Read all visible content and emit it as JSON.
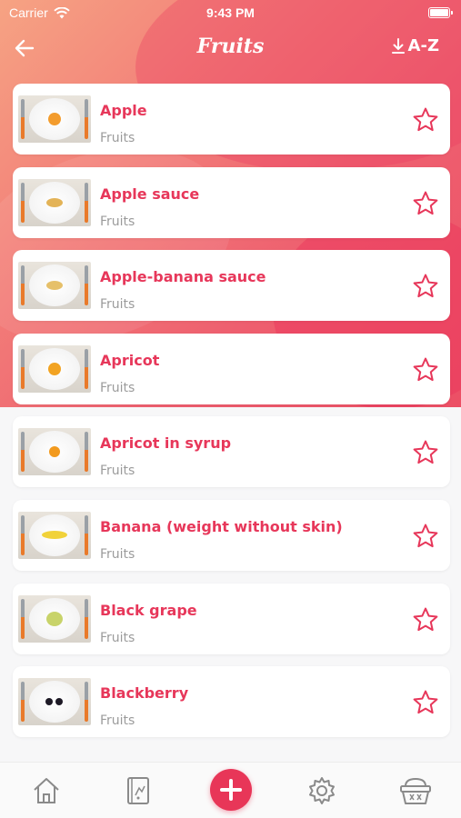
{
  "status": {
    "carrier": "Carrier",
    "time": "9:43 PM"
  },
  "nav": {
    "title": "Fruits",
    "sort_label": "A-Z"
  },
  "items": [
    {
      "name": "Apple",
      "category": "Fruits",
      "food_color": "#f39c2d"
    },
    {
      "name": "Apple sauce",
      "category": "Fruits",
      "food_color": "#e3b357"
    },
    {
      "name": "Apple-banana sauce",
      "category": "Fruits",
      "food_color": "#e6c06a"
    },
    {
      "name": "Apricot",
      "category": "Fruits",
      "food_color": "#f2a322"
    },
    {
      "name": "Apricot in syrup",
      "category": "Fruits",
      "food_color": "#f29a1e"
    },
    {
      "name": "Banana (weight without skin)",
      "category": "Fruits",
      "food_color": "#f1d23a"
    },
    {
      "name": "Black grape",
      "category": "Fruits",
      "food_color": "#c8d36a"
    },
    {
      "name": "Blackberry",
      "category": "Fruits",
      "food_color": "#1e1a26"
    }
  ],
  "tabs": [
    {
      "icon": "home-icon"
    },
    {
      "icon": "diary-icon"
    },
    {
      "icon": "add-icon"
    },
    {
      "icon": "settings-icon"
    },
    {
      "icon": "basket-icon"
    }
  ],
  "colors": {
    "accent": "#e7375a",
    "category_text": "#9b9b9b"
  }
}
